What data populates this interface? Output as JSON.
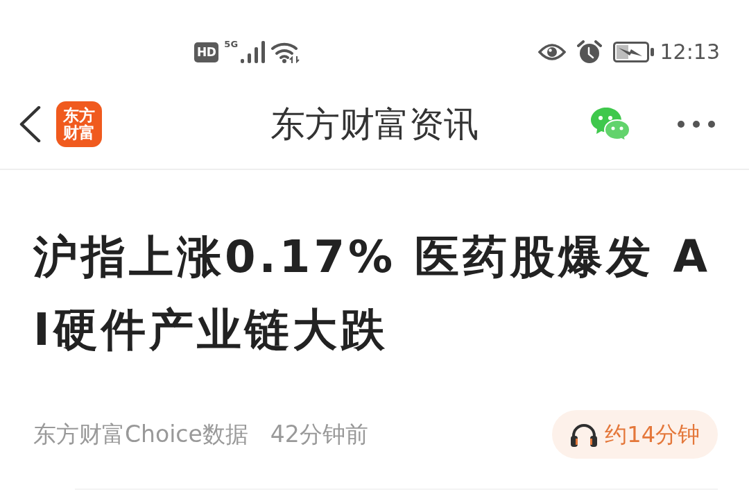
{
  "status_bar": {
    "hd_badge": "HD",
    "network": "5G",
    "time": "12:13"
  },
  "header": {
    "logo_text": "东方财富",
    "title": "东方财富资讯"
  },
  "article": {
    "title": "沪指上涨0.17% 医药股爆发 AI硬件产业链大跌",
    "source": "东方财富Choice数据",
    "time": "42分钟前",
    "audio_duration": "约14分钟"
  }
}
